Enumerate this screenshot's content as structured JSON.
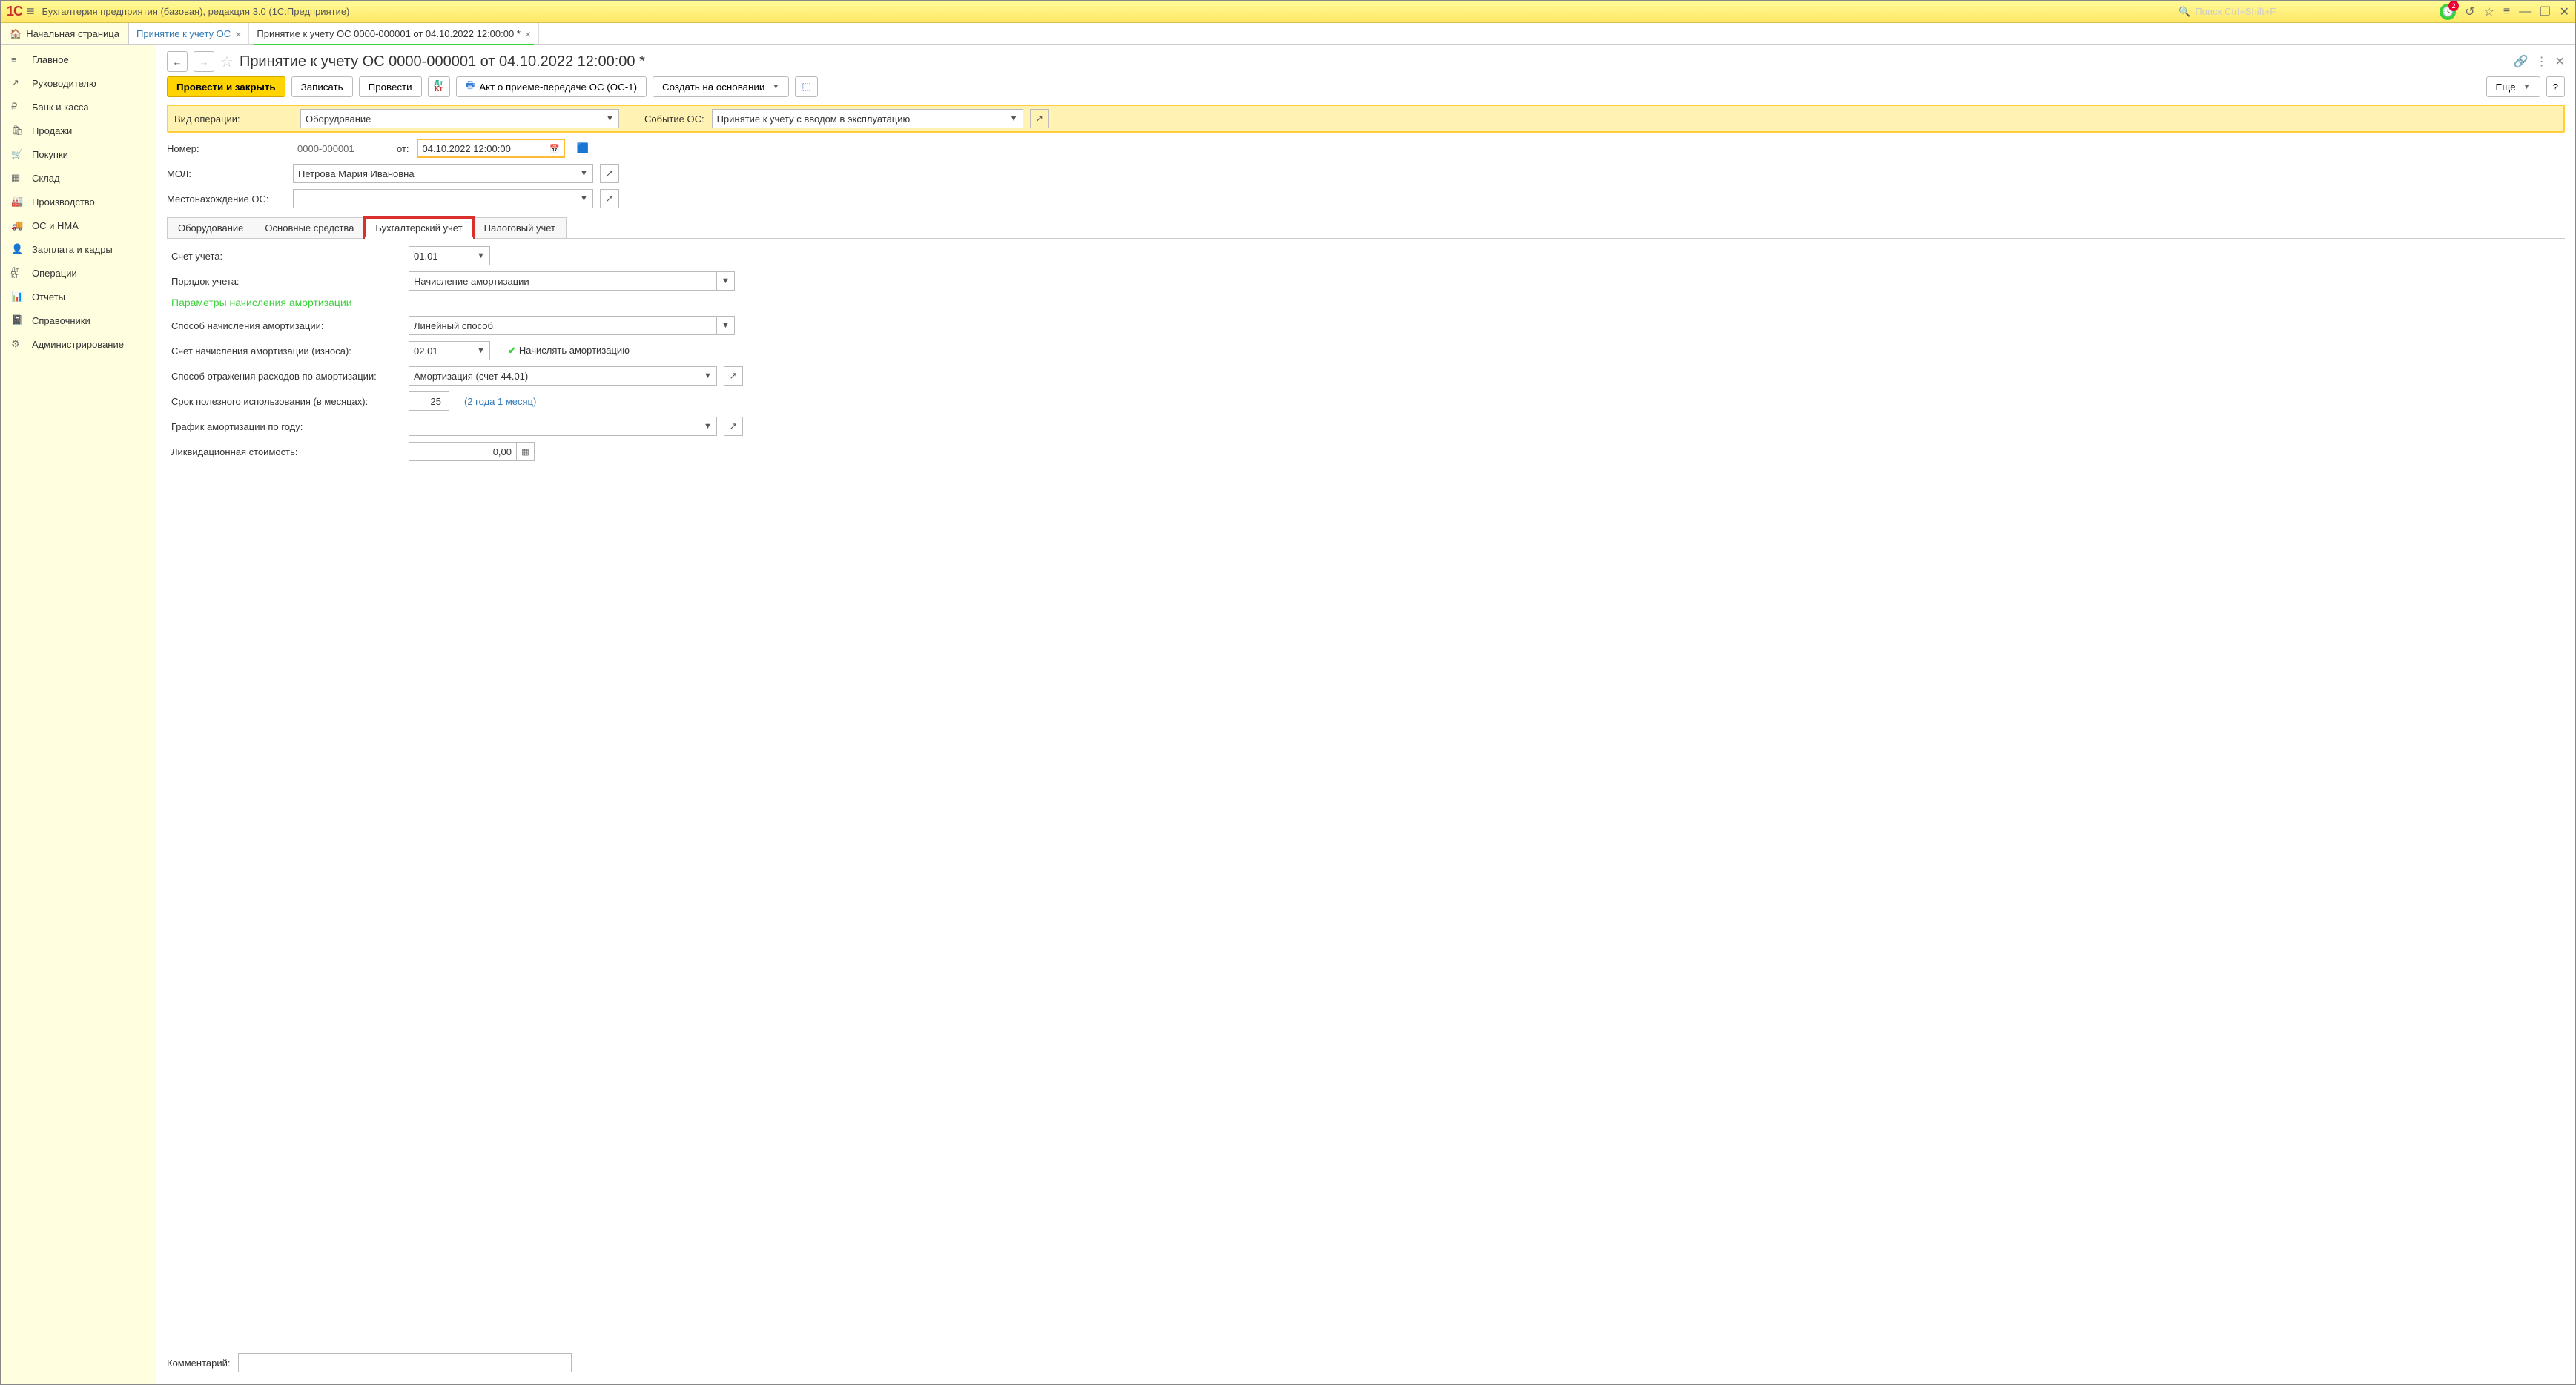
{
  "titlebar": {
    "app_title": "Бухгалтерия предприятия (базовая), редакция 3.0  (1С:Предприятие)",
    "search_placeholder": "Поиск Ctrl+Shift+F",
    "notif_count": "2"
  },
  "tabstrip": {
    "home_label": "Начальная страница",
    "tabs": [
      {
        "label": "Принятие к учету ОС",
        "active": false
      },
      {
        "label": "Принятие к учету ОС 0000-000001 от 04.10.2022 12:00:00 *",
        "active": true
      }
    ]
  },
  "sidebar": {
    "items": [
      {
        "icon": "≡",
        "label": "Главное"
      },
      {
        "icon": "↗",
        "label": "Руководителю"
      },
      {
        "icon": "₽",
        "label": "Банк и касса"
      },
      {
        "icon": "🛍",
        "label": "Продажи"
      },
      {
        "icon": "🛒",
        "label": "Покупки"
      },
      {
        "icon": "▦",
        "label": "Склад"
      },
      {
        "icon": "🏭",
        "label": "Производство"
      },
      {
        "icon": "🚚",
        "label": "ОС и НМА"
      },
      {
        "icon": "👤",
        "label": "Зарплата и кадры"
      },
      {
        "icon": "Дк",
        "label": "Операции"
      },
      {
        "icon": "📊",
        "label": "Отчеты"
      },
      {
        "icon": "📓",
        "label": "Справочники"
      },
      {
        "icon": "⚙",
        "label": "Администрирование"
      }
    ]
  },
  "header": {
    "title": "Принятие к учету ОС 0000-000001 от 04.10.2022 12:00:00 *"
  },
  "toolbar": {
    "post_close": "Провести и закрыть",
    "save": "Записать",
    "post": "Провести",
    "print": "Акт о приеме-передаче ОС (ОС-1)",
    "create_based": "Создать на основании",
    "more": "Еще",
    "help": "?"
  },
  "form1": {
    "op_label": "Вид операции:",
    "op_value": "Оборудование",
    "event_label": "Событие ОС:",
    "event_value": "Принятие к учету с вводом в эксплуатацию",
    "num_label": "Номер:",
    "num_value": "0000-000001",
    "date_from": "от:",
    "date_value": "04.10.2022 12:00:00",
    "mol_label": "МОЛ:",
    "mol_value": "Петрова Мария Ивановна",
    "loc_label": "Местонахождение ОС:",
    "loc_value": ""
  },
  "itabs": [
    "Оборудование",
    "Основные средства",
    "Бухгалтерский учет",
    "Налоговый учет"
  ],
  "acct": {
    "acct_label": "Счет учета:",
    "acct_value": "01.01",
    "order_label": "Порядок учета:",
    "order_value": "Начисление амортизации",
    "params_head": "Параметры начисления амортизации",
    "method_label": "Способ начисления амортизации:",
    "method_value": "Линейный способ",
    "amacct_label": "Счет начисления амортизации (износа):",
    "amacct_value": "02.01",
    "calc_check": "Начислять амортизацию",
    "exp_label": "Способ отражения расходов по амортизации:",
    "exp_value": "Амортизация (счет 44.01)",
    "term_label": "Срок полезного использования (в месяцах):",
    "term_value": "25",
    "term_hint": "(2 года 1 месяц)",
    "sched_label": "График амортизации по году:",
    "sched_value": "",
    "liq_label": "Ликвидационная стоимость:",
    "liq_value": "0,00"
  },
  "footer": {
    "comment_label": "Комментарий:",
    "comment_value": ""
  }
}
